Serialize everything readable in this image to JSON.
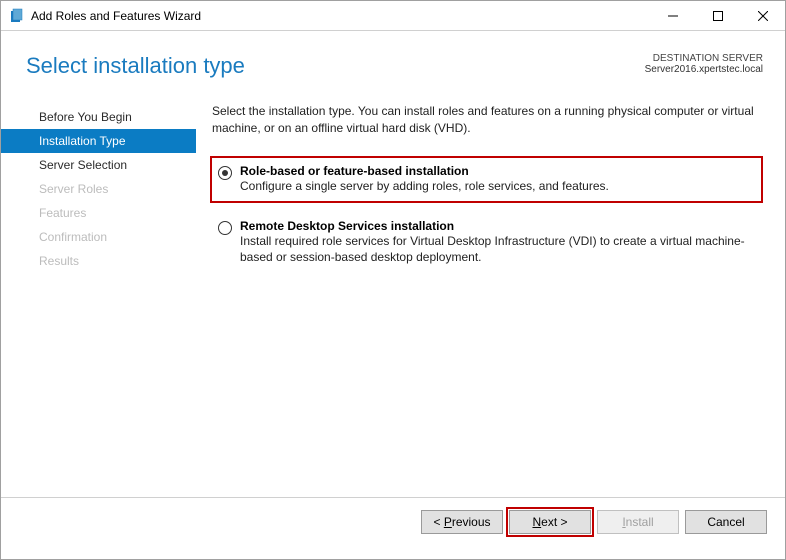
{
  "window": {
    "title": "Add Roles and Features Wizard"
  },
  "header": {
    "title": "Select installation type",
    "dest_label": "DESTINATION SERVER",
    "dest_server": "Server2016.xpertstec.local"
  },
  "sidebar": {
    "items": [
      {
        "label": "Before You Begin",
        "state": "normal"
      },
      {
        "label": "Installation Type",
        "state": "active"
      },
      {
        "label": "Server Selection",
        "state": "normal"
      },
      {
        "label": "Server Roles",
        "state": "disabled"
      },
      {
        "label": "Features",
        "state": "disabled"
      },
      {
        "label": "Confirmation",
        "state": "disabled"
      },
      {
        "label": "Results",
        "state": "disabled"
      }
    ]
  },
  "content": {
    "intro": "Select the installation type. You can install roles and features on a running physical computer or virtual machine, or on an offline virtual hard disk (VHD).",
    "options": [
      {
        "title": "Role-based or feature-based installation",
        "desc": "Configure a single server by adding roles, role services, and features.",
        "checked": true,
        "highlighted": true
      },
      {
        "title": "Remote Desktop Services installation",
        "desc": "Install required role services for Virtual Desktop Infrastructure (VDI) to create a virtual machine-based or session-based desktop deployment.",
        "checked": false,
        "highlighted": false
      }
    ]
  },
  "footer": {
    "previous_prefix": "< ",
    "previous_ul": "P",
    "previous_rest": "revious",
    "next_ul": "N",
    "next_rest": "ext >",
    "install_ul": "I",
    "install_rest": "nstall",
    "cancel": "Cancel"
  }
}
